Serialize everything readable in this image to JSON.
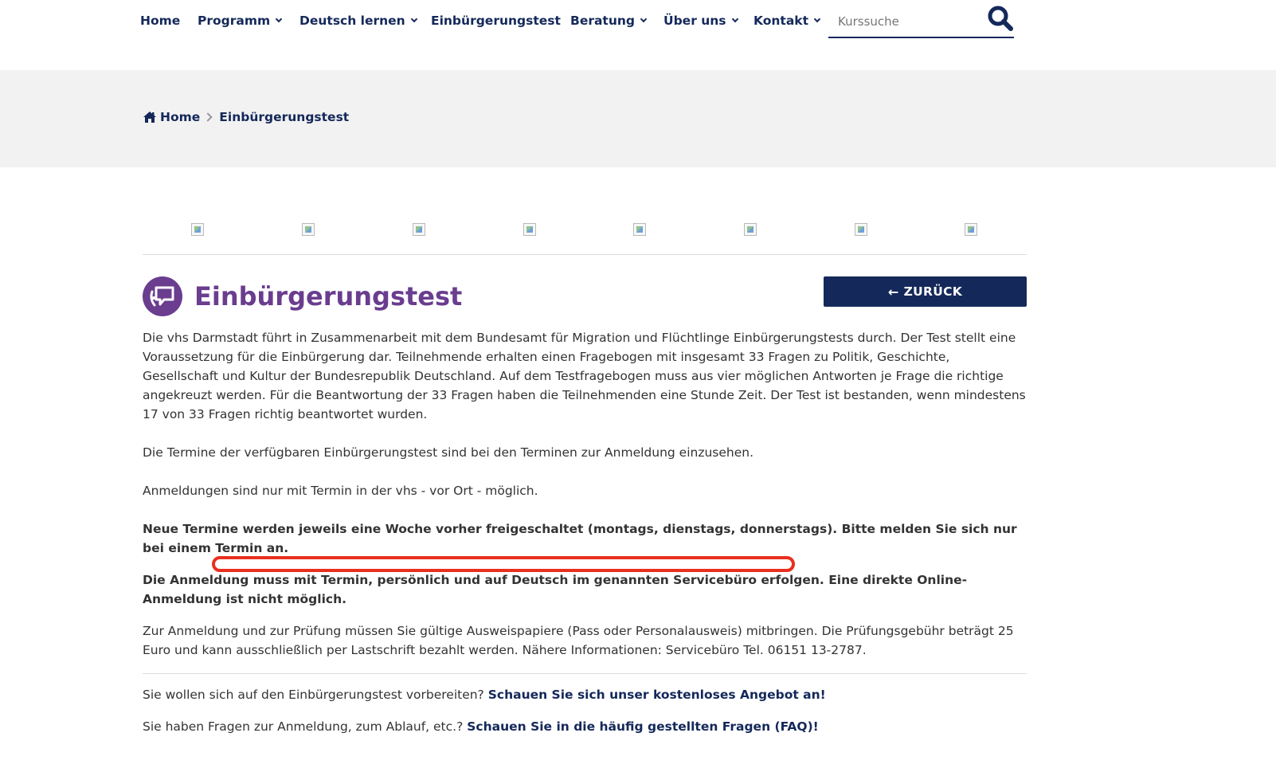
{
  "nav": {
    "items": [
      {
        "label": "Home",
        "dropdown": false
      },
      {
        "label": "Programm",
        "dropdown": true
      },
      {
        "label": "Deutsch lernen",
        "dropdown": true
      },
      {
        "label": "Einbürgerungstest",
        "dropdown": false
      },
      {
        "label": "Beratung",
        "dropdown": true
      },
      {
        "label": "Über uns",
        "dropdown": true
      },
      {
        "label": "Kontakt",
        "dropdown": true
      }
    ],
    "search_placeholder": "Kurssuche",
    "search_icon": "search-icon"
  },
  "breadcrumb": {
    "home_icon": "home-icon",
    "home_label": "Home",
    "current": "Einbürgerungstest"
  },
  "icon_strip": {
    "count": 8,
    "icon": "broken-image-icon"
  },
  "page": {
    "title": "Einbürgerungstest",
    "title_icon": "speech-bubble-icon",
    "back_button": "ZURÜCK",
    "back_icon": "arrow-left-icon"
  },
  "content": {
    "p1": "Die vhs Darmstadt führt in Zusammenarbeit mit dem Bundesamt für Migration und Flüchtlinge Einbürgerungstests durch. Der Test stellt eine Voraussetzung für die Einbürgerung dar. Teilnehmende erhalten einen Fragebogen mit insgesamt 33 Fragen zu Politik, Geschichte, Gesellschaft und Kultur der Bundesrepublik Deutschland. Auf dem Testfragebogen muss aus vier möglichen Antworten je Frage die richtige angekreuzt werden. Für die Beantwortung der 33 Fragen haben die Teilnehmenden eine Stunde Zeit. Der Test ist bestanden, wenn mindestens 17 von 33 Fragen richtig beantwortet wurden.",
    "p2": "Die Termine der verfügbaren Einbürgerungstest sind bei den Terminen zur Anmeldung einzusehen.",
    "p3": "Anmeldungen sind nur mit Termin in der vhs - vor Ort - möglich.",
    "p4": "Neue Termine werden jeweils eine Woche vorher freigeschaltet (montags, dienstags, donnerstags). Bitte melden Sie sich nur bei einem Termin an.",
    "p5": "Die Anmeldung muss mit Termin, persönlich und auf Deutsch im genannten Servicebüro erfolgen. Eine direkte Online-Anmeldung ist nicht möglich.",
    "p6": "Zur Anmeldung und zur Prüfung müssen Sie gültige Ausweispapiere (Pass oder Personalausweis) mitbringen. Die Prüfungsgebühr beträgt 25 Euro und kann ausschließlich per Lastschrift bezahlt werden. Nähere Informationen: Servicebüro Tel. 06151 13-2787.",
    "p7_text": "Sie wollen sich auf den Einbürgerungstest vorbereiten?",
    "p7_link": "Schauen Sie sich unser kostenloses Angebot an!",
    "p8_text": "Sie haben Fragen zur Anmeldung, zum Ablauf, etc.?",
    "p8_link": "Schauen Sie in die häufig gestellten Fragen (FAQ)!"
  },
  "colors": {
    "navy": "#14285a",
    "purple": "#6a3d8f",
    "band": "#f2f2f2",
    "highlight": "#e8301e"
  }
}
